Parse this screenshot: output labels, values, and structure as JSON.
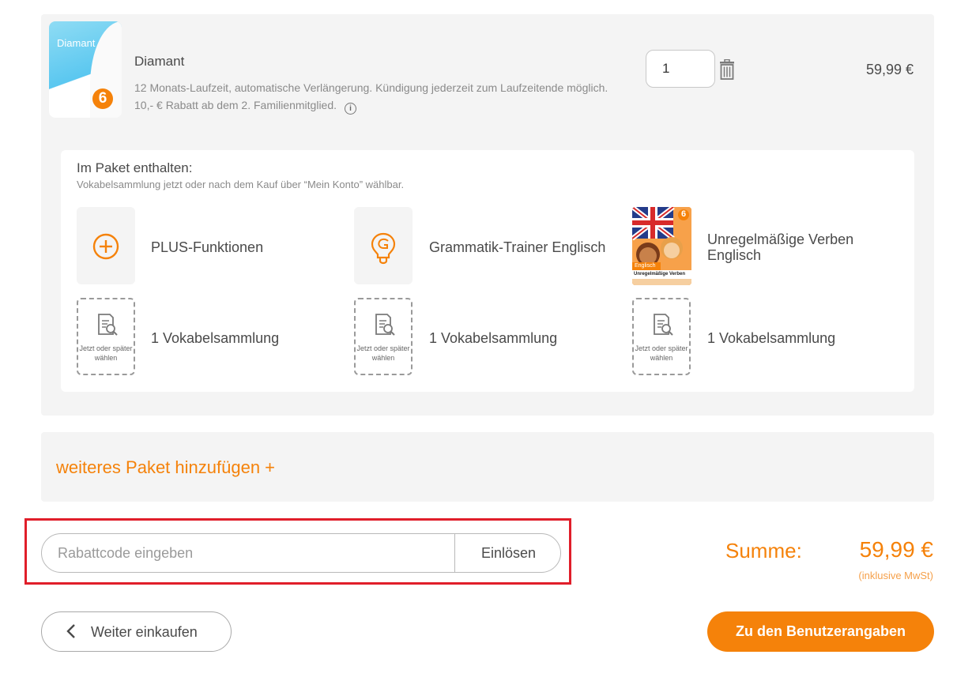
{
  "product": {
    "thumb_label": "Diamant",
    "thumb_logo": "6",
    "title": "Diamant",
    "description": "12 Monats-Laufzeit, automatische Verlängerung. Kündigung jederzeit zum Laufzeitende möglich. 10,- € Rabatt ab dem 2. Familienmitglied.",
    "quantity": "1",
    "price": "59,99 €",
    "icons": {
      "info": "info-icon",
      "trash": "trash-icon"
    }
  },
  "included": {
    "title": "Im Paket enthalten:",
    "subtitle": "Vokabelsammlung jetzt oder nach dem Kauf über “Mein Konto” wählbar.",
    "features": [
      {
        "icon": "plus-circle-icon",
        "label": "PLUS-Funktionen"
      },
      {
        "icon": "lightbulb-icon",
        "label": "Grammatik-Trainer Englisch"
      },
      {
        "icon": "book-cover",
        "label": "Unregelmäßige Verben Englisch",
        "cover_logo": "6",
        "cover_tag": "Englisch",
        "cover_title": "Unregelmäßige Verben"
      }
    ],
    "vocab_slots": [
      {
        "tile_text": "Jetzt oder später wählen",
        "label": "1 Vokabelsammlung"
      },
      {
        "tile_text": "Jetzt oder später wählen",
        "label": "1 Vokabelsammlung"
      },
      {
        "tile_text": "Jetzt oder später wählen",
        "label": "1 Vokabelsammlung"
      }
    ]
  },
  "add_package": {
    "label": "weiteres Paket hinzufügen +"
  },
  "coupon": {
    "placeholder": "Rabattcode eingeben",
    "value": "",
    "button": "Einlösen"
  },
  "summary": {
    "label": "Summe:",
    "value": "59,99 €",
    "note": "(inklusive MwSt)"
  },
  "nav": {
    "back_label": "Weiter einkaufen",
    "next_label": "Zu den Benutzerangaben"
  },
  "colors": {
    "accent": "#f5820a",
    "highlight": "#e01e2a",
    "panel": "#f4f4f4"
  }
}
